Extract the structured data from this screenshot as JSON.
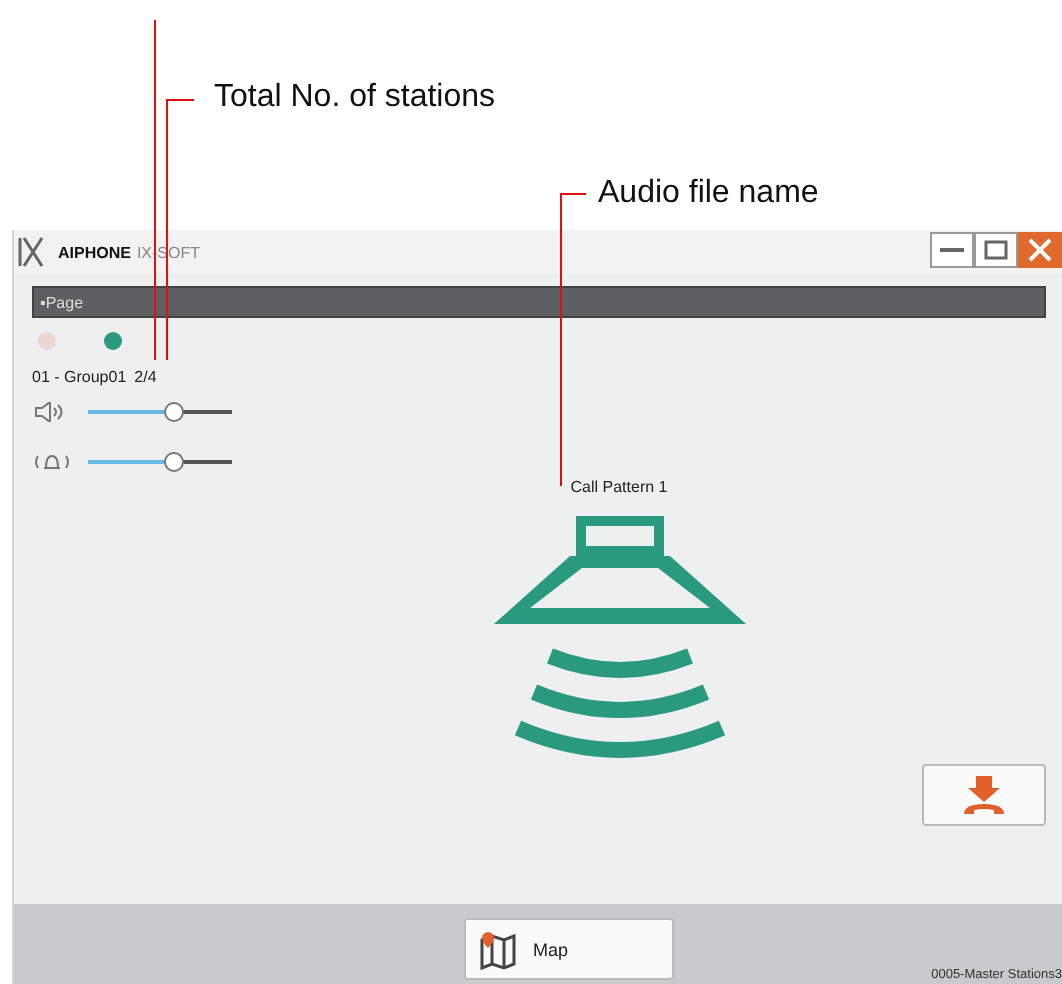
{
  "callouts": [
    {
      "label": "Total No. of stations"
    },
    {
      "label": "Audio file name"
    }
  ],
  "window": {
    "brand": "AIPHONE",
    "product": "IX-SOFT"
  },
  "panel_title": "▪Page",
  "indicators": [
    {
      "color": "#ecd6d2"
    },
    {
      "color": "#2a9a7e"
    }
  ],
  "group_label": "01 - Group01",
  "station_count": "2/4",
  "sliders": [
    {
      "kind": "speaker",
      "level": 0.6
    },
    {
      "kind": "ringer",
      "level": 0.6
    }
  ],
  "audio_file": "Call Pattern 1",
  "map_button": "Map",
  "status": "0005-Master Stations3"
}
